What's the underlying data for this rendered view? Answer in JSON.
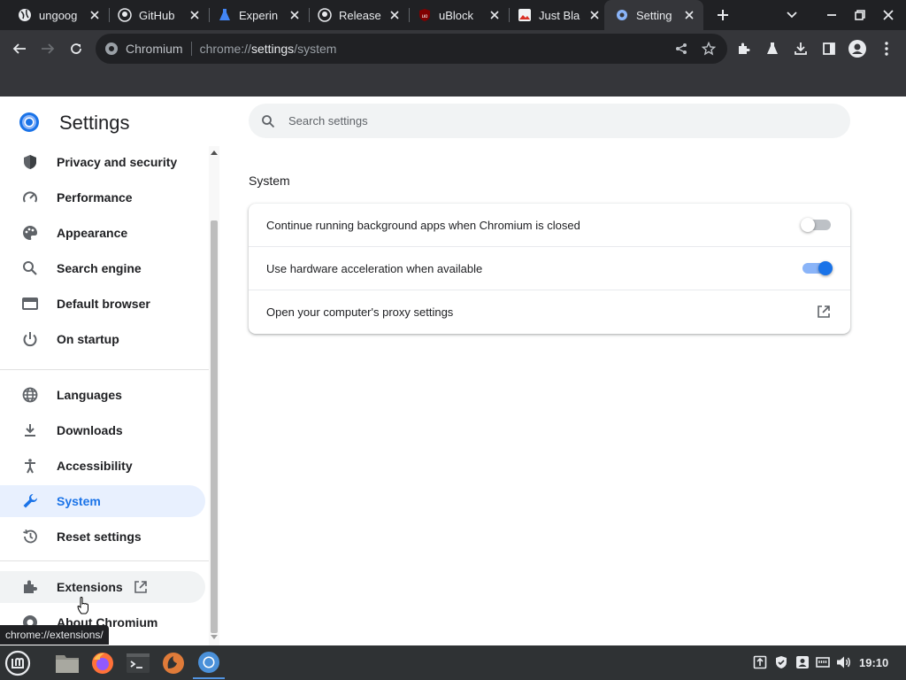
{
  "tabs": [
    {
      "title": "ungoog",
      "icon": "globe-icon"
    },
    {
      "title": "GitHub",
      "icon": "github-icon"
    },
    {
      "title": "Experin",
      "icon": "flask-icon"
    },
    {
      "title": "Release",
      "icon": "github-icon"
    },
    {
      "title": "uBlock",
      "icon": "ublock-icon"
    },
    {
      "title": "Just Bla",
      "icon": "image-icon"
    },
    {
      "title": "Setting",
      "icon": "gear-icon",
      "active": true
    }
  ],
  "omnibox": {
    "site_chip": "Chromium",
    "url_scheme": "chrome://",
    "url_host": "settings",
    "url_path": "/system"
  },
  "settings": {
    "title": "Settings",
    "search_placeholder": "Search settings"
  },
  "sidebar": {
    "items": [
      {
        "label": "Privacy and security",
        "icon": "shield-icon"
      },
      {
        "label": "Performance",
        "icon": "speedometer-icon"
      },
      {
        "label": "Appearance",
        "icon": "palette-icon"
      },
      {
        "label": "Search engine",
        "icon": "search-icon"
      },
      {
        "label": "Default browser",
        "icon": "browser-icon"
      },
      {
        "label": "On startup",
        "icon": "power-icon"
      },
      {
        "label": "Languages",
        "icon": "globe-icon"
      },
      {
        "label": "Downloads",
        "icon": "download-icon"
      },
      {
        "label": "Accessibility",
        "icon": "accessibility-icon"
      },
      {
        "label": "System",
        "icon": "wrench-icon",
        "selected": true
      },
      {
        "label": "Reset settings",
        "icon": "restore-icon"
      },
      {
        "label": "Extensions",
        "icon": "puzzle-icon"
      },
      {
        "label": "About Chromium",
        "icon": "chromium-icon"
      }
    ]
  },
  "system": {
    "section_title": "System",
    "rows": [
      {
        "label": "Continue running background apps when Chromium is closed",
        "toggle": false
      },
      {
        "label": "Use hardware acceleration when available",
        "toggle": true
      },
      {
        "label": "Open your computer's proxy settings",
        "control": "open-in-new-icon"
      }
    ]
  },
  "status_bubble": "chrome://extensions/",
  "taskbar": {
    "clock": "19:10",
    "apps": [
      "mint-menu-icon",
      "files-icon",
      "firefox-icon",
      "terminal-icon",
      "ungoogled-chromium-icon",
      "chromium-icon"
    ],
    "tray": [
      "update-icon",
      "shield-icon",
      "user-icon",
      "network-icon",
      "volume-icon"
    ]
  },
  "colors": {
    "accent": "#1a73e8",
    "selected_bg": "#e8f0fe",
    "tab_strip": "#202124",
    "toolbar": "#35363a",
    "taskbar": "#2f3234"
  }
}
